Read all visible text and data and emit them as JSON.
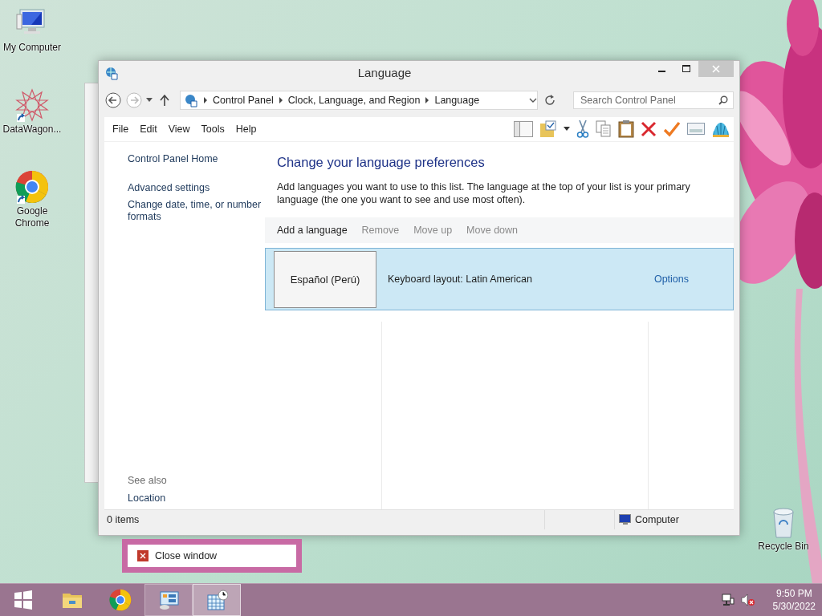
{
  "desktop_icons": [
    {
      "kind": "computer",
      "label": "My Computer"
    },
    {
      "kind": "star",
      "label": "DataWagon..."
    },
    {
      "kind": "chrome",
      "label": "Google Chrome"
    },
    {
      "kind": "bin",
      "label": "Recycle Bin"
    }
  ],
  "window": {
    "title": "Language",
    "address": {
      "breadcrumb": [
        "Control Panel",
        "Clock, Language, and Region",
        "Language"
      ],
      "search_placeholder": "Search Control Panel"
    },
    "menu": [
      "File",
      "Edit",
      "View",
      "Tools",
      "Help"
    ],
    "sidebar": {
      "links": [
        "Control Panel Home",
        "Advanced settings",
        "Change date, time, or number formats"
      ],
      "see_also_heading": "See also",
      "see_also_links": [
        "Location"
      ]
    },
    "main": {
      "heading": "Change your language preferences",
      "description": "Add languages you want to use to this list. The language at the top of your list is your primary language (the one you want to see and use most often).",
      "toolbar": [
        {
          "label": "Add a language",
          "disabled": false
        },
        {
          "label": "Remove",
          "disabled": true
        },
        {
          "label": "Move up",
          "disabled": true
        },
        {
          "label": "Move down",
          "disabled": true
        }
      ],
      "languages": [
        {
          "name": "Español (Perú)",
          "keyboard_layout": "Keyboard layout: Latin American",
          "options": "Options",
          "selected": true
        }
      ]
    },
    "status_bar": {
      "items": "0 items",
      "location": "Computer"
    }
  },
  "jump_list": {
    "items": [
      {
        "label": "Close window"
      }
    ]
  },
  "taskbar": {
    "buttons": [
      {
        "kind": "start",
        "selected": false,
        "open": false
      },
      {
        "kind": "explorer",
        "selected": false,
        "open": false
      },
      {
        "kind": "chrome",
        "selected": false,
        "open": false
      },
      {
        "kind": "control-panel",
        "selected": false,
        "open": true
      },
      {
        "kind": "calendar",
        "selected": true,
        "open": true
      }
    ],
    "clock": {
      "time": "9:50 PM",
      "date": "5/30/2022"
    }
  }
}
